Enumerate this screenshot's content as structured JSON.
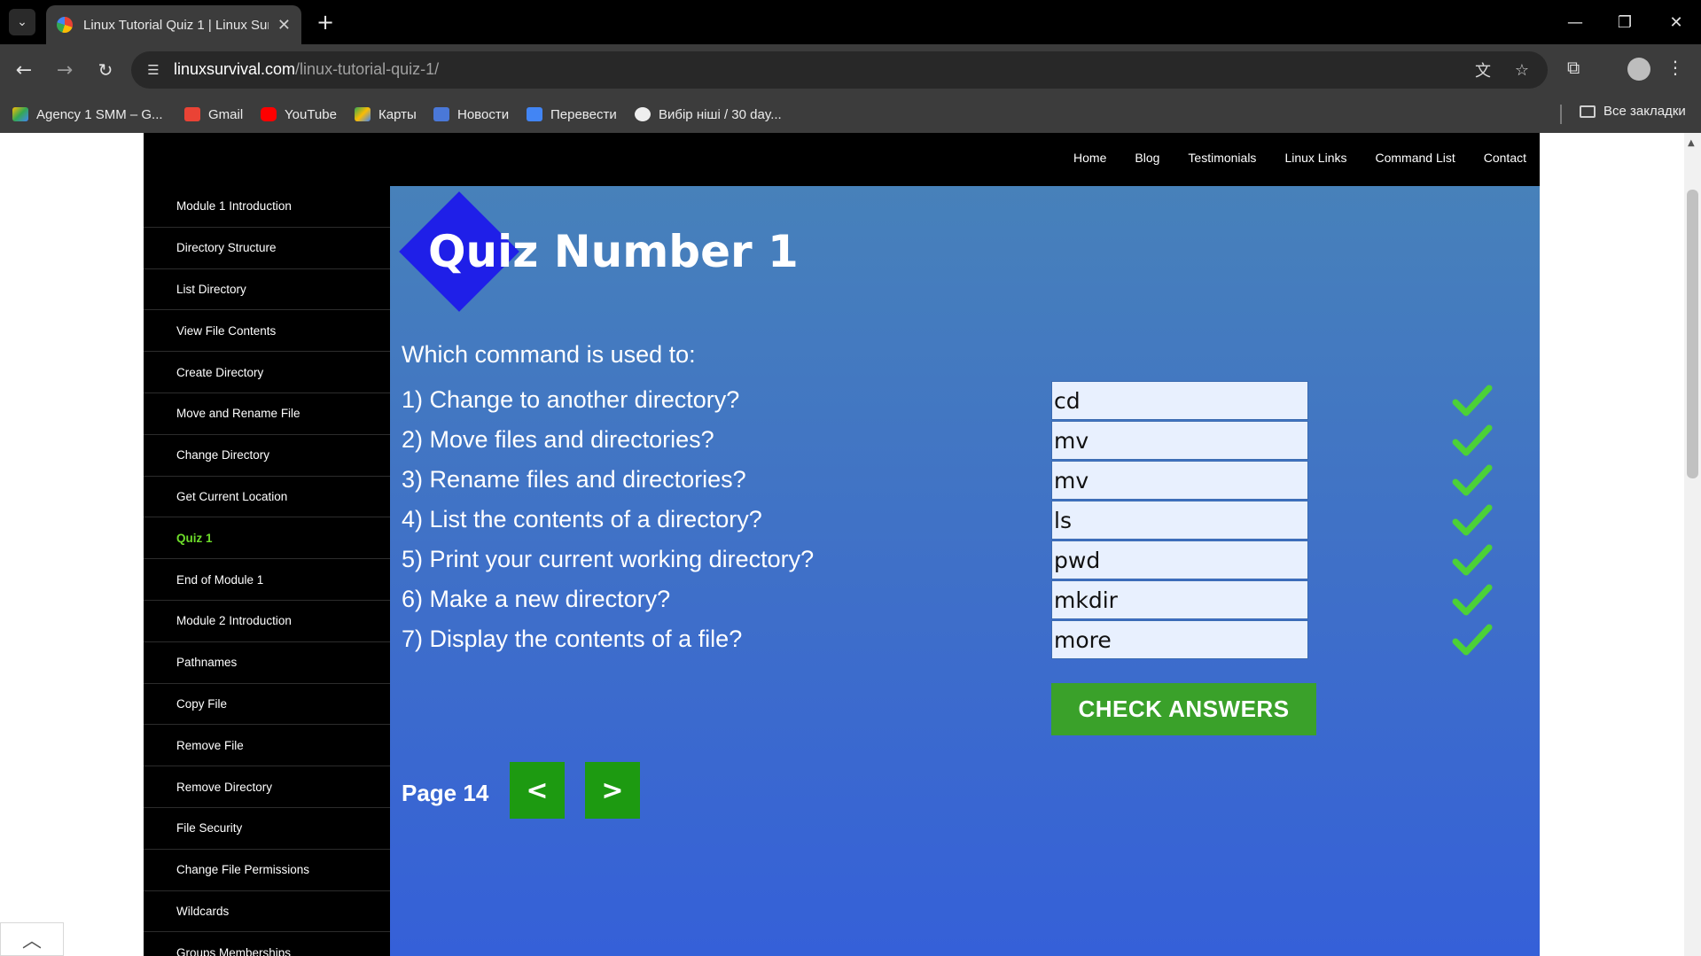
{
  "browser": {
    "tab_title": "Linux Tutorial Quiz 1 | Linux Sur",
    "url_host": "linuxsurvival.com",
    "url_path": "/linux-tutorial-quiz-1/",
    "bookmarks": [
      "Agency 1 SMM – G...",
      "Gmail",
      "YouTube",
      "Карты",
      "Новости",
      "Перевести",
      "Вибір ніші / 30 day..."
    ],
    "all_bookmarks": "Все закладки"
  },
  "topnav": [
    "Home",
    "Blog",
    "Testimonials",
    "Linux Links",
    "Command List",
    "Contact"
  ],
  "sidebar": [
    "Module 1 Introduction",
    "Directory Structure",
    "List Directory",
    "View File Contents",
    "Create Directory",
    "Move and Rename File",
    "Change Directory",
    "Get Current Location",
    "Quiz 1",
    "End of Module 1",
    "Module 2 Introduction",
    "Pathnames",
    "Copy File",
    "Remove File",
    "Remove Directory",
    "File Security",
    "Change File Permissions",
    "Wildcards",
    "Groups Memberships"
  ],
  "quiz": {
    "title": "Quiz Number 1",
    "intro": "Which command is used to:",
    "questions": [
      {
        "text": "1) Change to another directory?",
        "answer": "cd"
      },
      {
        "text": "2) Move files and directories?",
        "answer": "mv"
      },
      {
        "text": "3) Rename files and directories?",
        "answer": "mv"
      },
      {
        "text": "4) List the contents of a directory?",
        "answer": "ls"
      },
      {
        "text": "5) Print your current working directory?",
        "answer": "pwd"
      },
      {
        "text": "6) Make a new directory?",
        "answer": "mkdir"
      },
      {
        "text": "7) Display the contents of a file?",
        "answer": "more"
      }
    ],
    "check_label": "CHECK ANSWERS",
    "page_label": "Page 14",
    "prev_label": "<",
    "next_label": ">"
  },
  "colors": {
    "active_sidebar": "#6ddc2a",
    "check_button": "#3aa12a",
    "checkmark": "#4cd137"
  }
}
